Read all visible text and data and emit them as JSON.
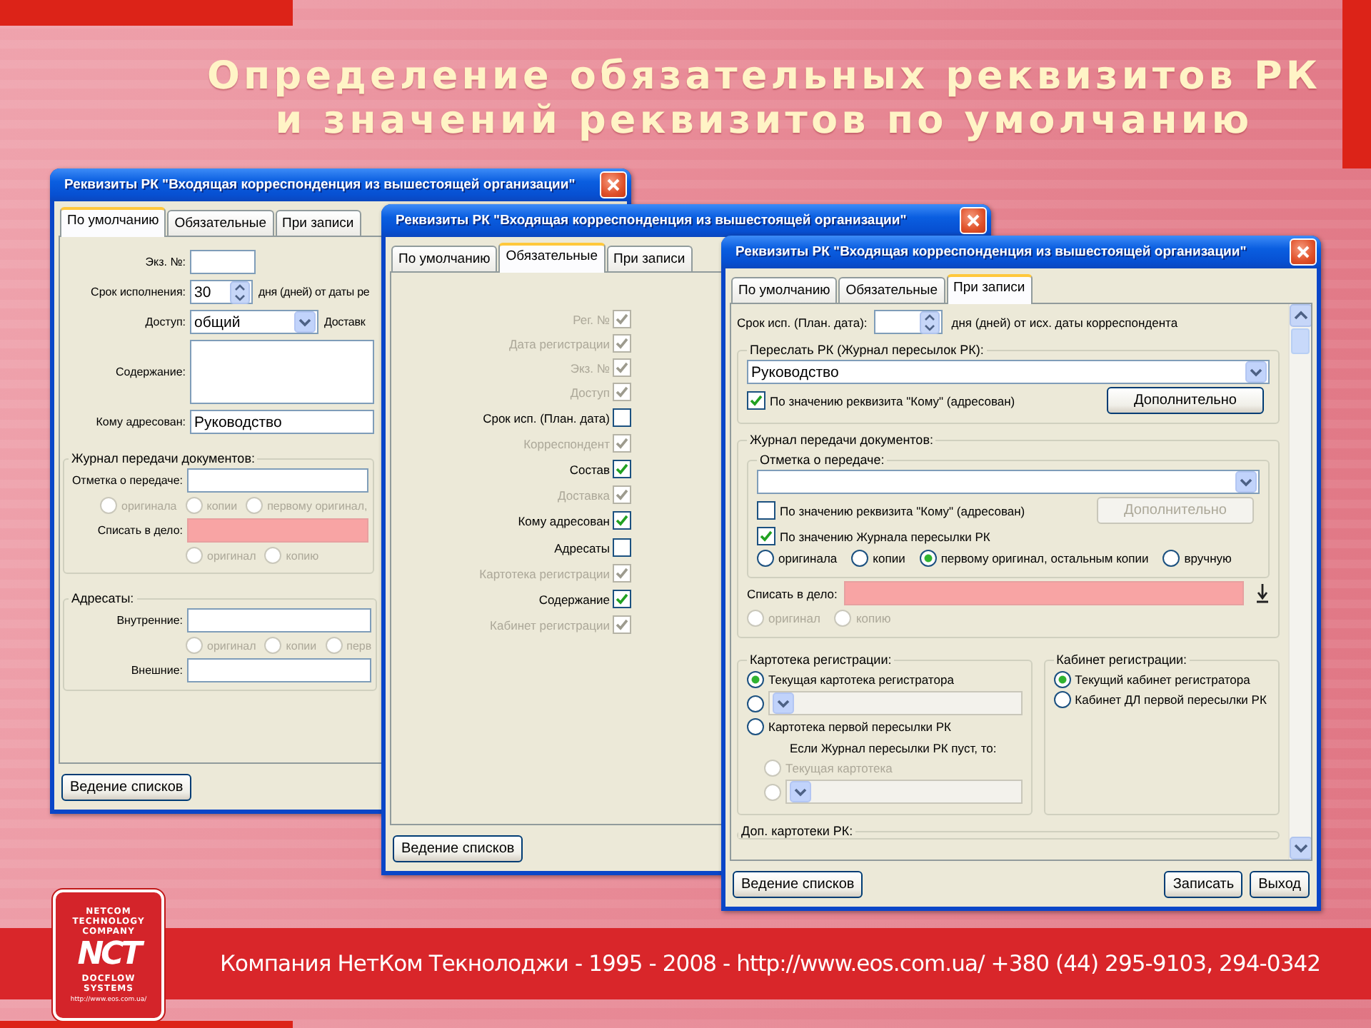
{
  "slide": {
    "title_lines": [
      "Определение обязательных реквизитов РК",
      "и значений реквизитов по умолчанию"
    ]
  },
  "windows": [
    {
      "kind": "defaults",
      "title": "Реквизиты РК \"Входящая корреспонденция из вышестоящей организации\"",
      "tabs": [
        {
          "label": "По умолчанию",
          "selected": true
        },
        {
          "label": "Обязательные",
          "selected": false
        },
        {
          "label": "При записи",
          "selected": false
        }
      ],
      "content": [
        {
          "kind": "number_field",
          "label": "Экз. №:",
          "highlighted": false
        },
        {
          "kind": "spin_field",
          "label": "Срок исполнения:",
          "value": "30",
          "after": "дня (дней) от даты ре",
          "highlighted": false
        },
        {
          "kind": "combo_field",
          "label": "Доступ:",
          "value": "общий",
          "after": "Доставк",
          "highlighted": false
        },
        {
          "kind": "area_field",
          "label": "Содержание:",
          "highlighted": false
        },
        {
          "kind": "text_field",
          "label": "Кому адресован:",
          "value": "Руководство",
          "highlighted": false
        },
        {
          "kind": "group",
          "title": "Журнал передачи документов:",
          "children": [
            {
              "kind": "text_field",
              "label": "Отметка о передаче:",
              "highlighted": false
            },
            {
              "kind": "radios",
              "disabled": true,
              "options": [
                {
                  "label": "оригинала",
                  "selected": false
                },
                {
                  "label": "копии",
                  "selected": false
                },
                {
                  "label": "первому оригинал,",
                  "selected": false
                }
              ]
            },
            {
              "kind": "text_field",
              "label": "Списать в дело:",
              "highlighted": true
            },
            {
              "kind": "radios",
              "disabled": true,
              "options": [
                {
                  "label": "оригинал",
                  "selected": false
                },
                {
                  "label": "копию",
                  "selected": false
                }
              ]
            }
          ]
        },
        {
          "kind": "group",
          "title": "Адресаты:",
          "children": [
            {
              "kind": "text_field",
              "label": "Внутренние:",
              "highlighted": false
            },
            {
              "kind": "radios",
              "disabled": true,
              "options": [
                {
                  "label": "оригинал",
                  "selected": false
                },
                {
                  "label": "копии",
                  "selected": false
                },
                {
                  "label": "перв",
                  "selected": false
                }
              ]
            },
            {
              "kind": "text_field",
              "label": "Внешние:",
              "highlighted": false
            }
          ]
        }
      ],
      "buttons": [
        {
          "label": "Ведение списков",
          "disabled": false
        }
      ]
    },
    {
      "kind": "required",
      "title": "Реквизиты РК \"Входящая корреспонденция из вышестоящей организации\"",
      "tabs": [
        {
          "label": "По умолчанию",
          "selected": false
        },
        {
          "label": "Обязательные",
          "selected": true
        },
        {
          "label": "При записи",
          "selected": false
        }
      ],
      "content": [
        {
          "kind": "check",
          "label": "Рег. №",
          "checked": true,
          "disabled": true
        },
        {
          "kind": "check",
          "label": "Дата регистрации",
          "checked": true,
          "disabled": true
        },
        {
          "kind": "check",
          "label": "Экз. №",
          "checked": true,
          "disabled": true
        },
        {
          "kind": "check",
          "label": "Доступ",
          "checked": true,
          "disabled": true
        },
        {
          "kind": "check",
          "label": "Срок исп. (План. дата)",
          "checked": false,
          "disabled": false
        },
        {
          "kind": "check",
          "label": "Корреспондент",
          "checked": true,
          "disabled": true
        },
        {
          "kind": "check",
          "label": "Состав",
          "checked": true,
          "disabled": false
        },
        {
          "kind": "check",
          "label": "Доставка",
          "checked": true,
          "disabled": true
        },
        {
          "kind": "check",
          "label": "Кому адресован",
          "checked": true,
          "disabled": false
        },
        {
          "kind": "check",
          "label": "Адресаты",
          "checked": false,
          "disabled": false
        },
        {
          "kind": "check",
          "label": "Картотека регистрации",
          "checked": true,
          "disabled": true
        },
        {
          "kind": "check",
          "label": "Содержание",
          "checked": true,
          "disabled": false
        },
        {
          "kind": "check",
          "label": "Кабинет регистрации",
          "checked": true,
          "disabled": true
        }
      ],
      "buttons": [
        {
          "label": "Ведение списков",
          "disabled": false
        }
      ]
    },
    {
      "kind": "on_save",
      "title": "Реквизиты РК \"Входящая корреспонденция из вышестоящей организации\"",
      "tabs": [
        {
          "label": "По умолчанию",
          "selected": false
        },
        {
          "label": "Обязательные",
          "selected": false
        },
        {
          "label": "При записи",
          "selected": true
        }
      ],
      "content": [
        {
          "kind": "spin_field",
          "label": "Срок исп. (План. дата):",
          "after": "дня (дней) от исх. даты корреспондента",
          "highlighted": false
        },
        {
          "kind": "group",
          "title": "Переслать РК (Журнал пересылок РК):",
          "children": [
            {
              "kind": "combo_field",
              "value": "Руководство",
              "highlighted": false
            },
            {
              "kind": "check",
              "label": "По значению реквизита \"Кому\" (адресован)",
              "checked": true,
              "disabled": false,
              "button": {
                "label": "Дополнительно",
                "disabled": false
              }
            }
          ]
        },
        {
          "kind": "group",
          "title": "Журнал передачи документов:",
          "children": [
            {
              "kind": "group",
              "title": "Отметка о передаче:",
              "children": [
                {
                  "kind": "combo_field",
                  "highlighted": false
                },
                {
                  "kind": "check",
                  "label": "По значению реквизита \"Кому\" (адресован)",
                  "checked": false,
                  "disabled": false,
                  "button": {
                    "label": "Дополнительно",
                    "disabled": true
                  }
                },
                {
                  "kind": "check",
                  "label": "По значению Журнала пересылки РК",
                  "checked": true,
                  "disabled": false
                },
                {
                  "kind": "radios",
                  "disabled": false,
                  "options": [
                    {
                      "label": "оригинала",
                      "selected": false
                    },
                    {
                      "label": "копии",
                      "selected": false
                    },
                    {
                      "label": "первому оригинал, остальным копии",
                      "selected": true
                    },
                    {
                      "label": "вручную",
                      "selected": false
                    }
                  ]
                }
              ]
            },
            {
              "kind": "pick_field",
              "label": "Списать в дело:",
              "highlighted": true
            },
            {
              "kind": "radios",
              "disabled": true,
              "options": [
                {
                  "label": "оригинал",
                  "selected": false
                },
                {
                  "label": "копию",
                  "selected": false
                }
              ]
            }
          ]
        },
        {
          "kind": "columns",
          "children": [
            {
              "kind": "group",
              "title": "Картотека регистрации:",
              "children": [
                {
                  "kind": "radio_list",
                  "disabled": false,
                  "options": [
                    {
                      "kind": "label",
                      "label": "Текущая картотека регистратора",
                      "selected": true
                    },
                    {
                      "kind": "combo",
                      "selected": false,
                      "field_disabled": true
                    },
                    {
                      "kind": "label",
                      "label": "Картотека первой пересылки РК",
                      "selected": false
                    }
                  ]
                },
                {
                  "kind": "text",
                  "text": "Если Журнал пересылки РК пуст, то:"
                },
                {
                  "kind": "radio_list",
                  "disabled": true,
                  "options": [
                    {
                      "kind": "label",
                      "label": "Текущая картотека",
                      "selected": false
                    },
                    {
                      "kind": "combo",
                      "selected": false,
                      "field_disabled": true
                    }
                  ]
                }
              ]
            },
            {
              "kind": "group",
              "title": "Кабинет регистрации:",
              "children": [
                {
                  "kind": "radio_list",
                  "disabled": false,
                  "options": [
                    {
                      "kind": "label",
                      "label": "Текущий кабинет регистратора",
                      "selected": true
                    },
                    {
                      "kind": "label",
                      "label": "Кабинет ДЛ первой пересылки РК",
                      "selected": false
                    }
                  ]
                }
              ]
            }
          ]
        },
        {
          "kind": "group",
          "title": "Доп. картотеки РК:"
        }
      ],
      "buttons": [
        {
          "label": "Ведение списков",
          "disabled": false
        },
        {
          "label": "Записать",
          "disabled": false
        },
        {
          "label": "Выход",
          "disabled": false
        }
      ]
    }
  ],
  "footer": {
    "logo": {
      "top_lines": [
        "NETCOM",
        "TECHNOLOGY",
        "COMPANY"
      ],
      "mark": "NCT",
      "bottom_lines": [
        "DOCFLOW",
        "SYSTEMS"
      ],
      "url": "http://www.eos.com.ua/"
    },
    "text": "Компания НетКом Текнолоджи - 1995 - 2008 - http://www.eos.com.ua/ +380 (44) 295-9103, 294-0342"
  }
}
